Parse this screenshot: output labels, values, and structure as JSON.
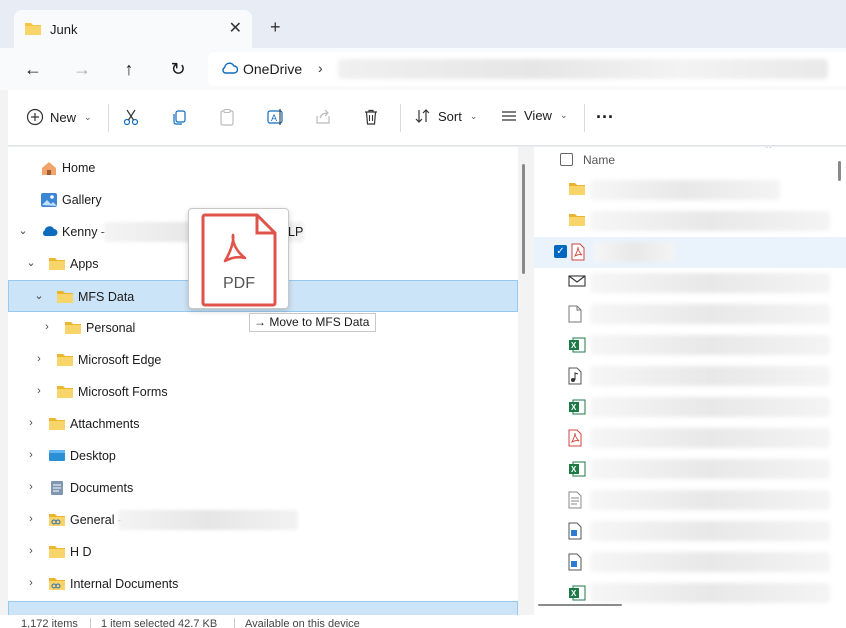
{
  "tab": {
    "title": "Junk",
    "close": "✕",
    "new": "+"
  },
  "nav": {
    "back": "←",
    "forward": "→",
    "up": "↑",
    "refresh": "↻"
  },
  "address": {
    "root": "OneDrive",
    "separator": "›"
  },
  "toolbar": {
    "new_label": "New",
    "sort_label": "Sort",
    "view_label": "View",
    "more_label": "..."
  },
  "tree": [
    {
      "label": "Home",
      "icon": "home-icon",
      "indent": 0,
      "expand": ""
    },
    {
      "label": "Gallery",
      "icon": "gallery-icon",
      "indent": 0,
      "expand": ""
    },
    {
      "label": "Kenny -",
      "suffix": "LP",
      "icon": "onedrive-cloud-icon",
      "indent": 0,
      "expand": "⌄"
    },
    {
      "label": "Apps",
      "icon": "folder-icon",
      "indent": 1,
      "expand": "⌄"
    },
    {
      "label": "MFS Data",
      "icon": "folder-icon",
      "indent": 2,
      "expand": "⌄",
      "selected": true
    },
    {
      "label": "Personal",
      "icon": "folder-icon",
      "indent": 3,
      "expand": "›"
    },
    {
      "label": "Microsoft Edge",
      "icon": "folder-icon",
      "indent": 2,
      "expand": "›"
    },
    {
      "label": "Microsoft Forms",
      "icon": "folder-icon",
      "indent": 2,
      "expand": "›"
    },
    {
      "label": "Attachments",
      "icon": "folder-icon",
      "indent": 1,
      "expand": "›"
    },
    {
      "label": "Desktop",
      "icon": "desktop-icon",
      "indent": 1,
      "expand": "›"
    },
    {
      "label": "Documents",
      "icon": "documents-icon",
      "indent": 1,
      "expand": "›"
    },
    {
      "label": "General -",
      "icon": "shared-folder-icon",
      "indent": 1,
      "expand": "›"
    },
    {
      "label": "H D",
      "icon": "folder-icon",
      "indent": 1,
      "expand": "›"
    },
    {
      "label": "Internal Documents",
      "icon": "shared-folder-icon",
      "indent": 1,
      "expand": "›"
    }
  ],
  "list": {
    "header_name": "Name",
    "items": [
      {
        "icon": "folder-icon"
      },
      {
        "icon": "folder-icon"
      },
      {
        "icon": "pdf-icon",
        "checked": true
      },
      {
        "icon": "mail-icon"
      },
      {
        "icon": "blank-file-icon"
      },
      {
        "icon": "excel-icon"
      },
      {
        "icon": "media-file-icon"
      },
      {
        "icon": "excel-icon"
      },
      {
        "icon": "pdf-icon"
      },
      {
        "icon": "excel-icon"
      },
      {
        "icon": "text-file-icon"
      },
      {
        "icon": "word-doc-icon"
      },
      {
        "icon": "word-doc-icon"
      },
      {
        "icon": "excel-icon"
      }
    ]
  },
  "drag": {
    "ghost_label": "PDF",
    "tooltip": "Move to MFS Data",
    "arrow": "→"
  },
  "status": {
    "count": "1,172 items",
    "selected": "1 item selected  42.7 KB",
    "availability": "Available on this device"
  },
  "colors": {
    "folder": "#f4c542",
    "accent": "#0067c0",
    "selection": "#cce4f7",
    "pdf_red": "#e0534a",
    "excel_green": "#1d7a45"
  }
}
